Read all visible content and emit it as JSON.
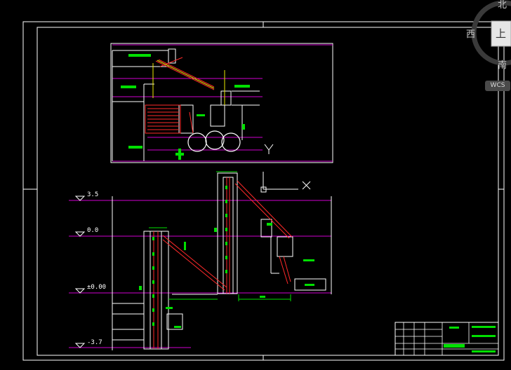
{
  "viewcube": {
    "north": "北",
    "west": "西",
    "south": "南",
    "top": "上"
  },
  "wcs_label": "WCS",
  "elevations": [
    "3.5",
    "0.0",
    "±0.00",
    "-3.7"
  ],
  "colors": {
    "background": "#000000",
    "frame": "#ffffff",
    "magenta": "#d000d0",
    "red": "#ff2a2a",
    "green": "#00e000",
    "yellow": "#e8e800",
    "cyan": "#00e0e0"
  }
}
